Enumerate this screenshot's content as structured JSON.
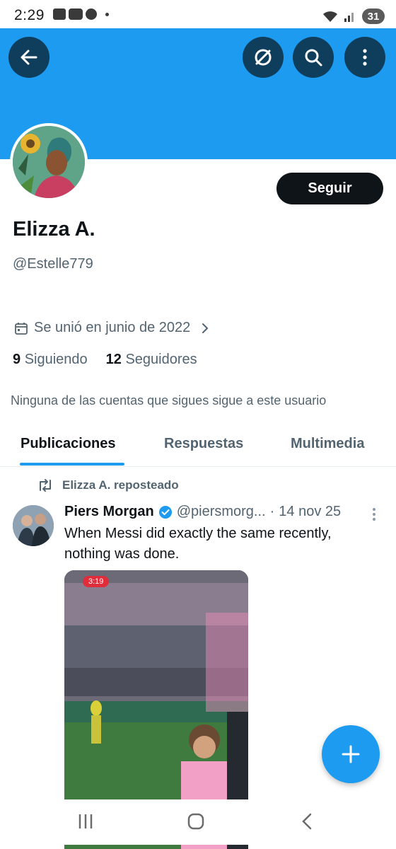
{
  "status_bar": {
    "time": "2:29",
    "battery": "31"
  },
  "colors": {
    "accent": "#1d9bf0",
    "banner": "#1d9bf0",
    "dark_button": "#0f1419",
    "secondary_text": "#536471"
  },
  "top_bar": {
    "icons": [
      "back-arrow-icon",
      "grok-icon",
      "search-icon",
      "more-vertical-icon"
    ]
  },
  "profile": {
    "display_name": "Elizza A.",
    "handle": "@Estelle779",
    "follow_label": "Seguir",
    "joined": "Se unió en junio de 2022",
    "following_count": "9",
    "following_label": "Siguiendo",
    "followers_count": "12",
    "followers_label": "Seguidores",
    "mutual_note": "Ninguna de las cuentas que sigues sigue a este usuario"
  },
  "tabs": [
    {
      "label": "Publicaciones",
      "active": true
    },
    {
      "label": "Respuestas",
      "active": false
    },
    {
      "label": "Multimedia",
      "active": false
    }
  ],
  "post": {
    "repost_label": "Elizza A. reposteado",
    "author": "Piers Morgan",
    "verified": true,
    "handle": "@piersmorg...",
    "separator": "·",
    "date": "14 nov 25",
    "text": "When Messi did exactly the same recently, nothing was done.",
    "media_badge": "3:19"
  }
}
